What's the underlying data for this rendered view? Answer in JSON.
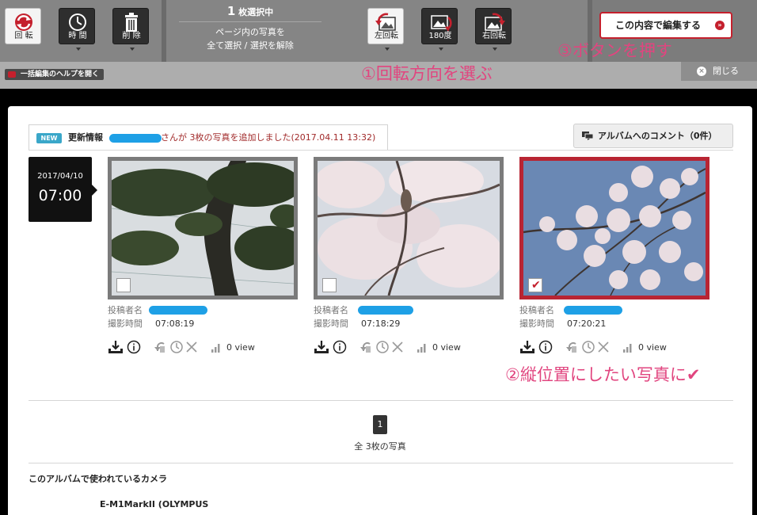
{
  "toolbar": {
    "rotate_label": "回 転",
    "time_label": "時 間",
    "delete_label": "削 除",
    "select_count_num": "1",
    "select_count_suffix": "枚選択中",
    "select_line1": "ページ内の写真を",
    "select_line2": "全て選択 / 選択を解除",
    "rotate_left_label": "左回転",
    "rotate_180_label": "180度",
    "rotate_right_label": "右回転",
    "edit_button_label": "この内容で編集する"
  },
  "help": {
    "open_label": "一括編集のヘルプを開く",
    "close_label": "閉じる"
  },
  "annotations": {
    "step1": "①回転方向を選ぶ",
    "step2": "②縦位置にしたい写真に✔",
    "step3": "③ボタンを押す"
  },
  "news": {
    "badge": "NEW",
    "heading": "更新情報",
    "message": "さんが 3枚の写真を追加しました(2017.04.11 13:32)"
  },
  "comment_button_label": "アルバムへのコメント（0件）",
  "date_box": {
    "date": "2017/04/10",
    "time": "07:00"
  },
  "photos": [
    {
      "poster_key": "投稿者名",
      "time_key": "撮影時間",
      "time": "07:08:19",
      "views": "0 view",
      "selected": false
    },
    {
      "poster_key": "投稿者名",
      "time_key": "撮影時間",
      "time": "07:18:29",
      "views": "0 view",
      "selected": false
    },
    {
      "poster_key": "投稿者名",
      "time_key": "撮影時間",
      "time": "07:20:21",
      "views": "0 view",
      "selected": true
    }
  ],
  "pagination": {
    "current_page": "1",
    "total_label": "全 3枚の写真"
  },
  "camera": {
    "title": "このアルバムで使われているカメラ",
    "name": "E-M1MarkII (OLYMPUS"
  },
  "colors": {
    "accent_red": "#c4202d",
    "annotation_pink": "#e1457f",
    "redaction_blue": "#1ea0e6",
    "new_badge": "#3aa7c9"
  }
}
